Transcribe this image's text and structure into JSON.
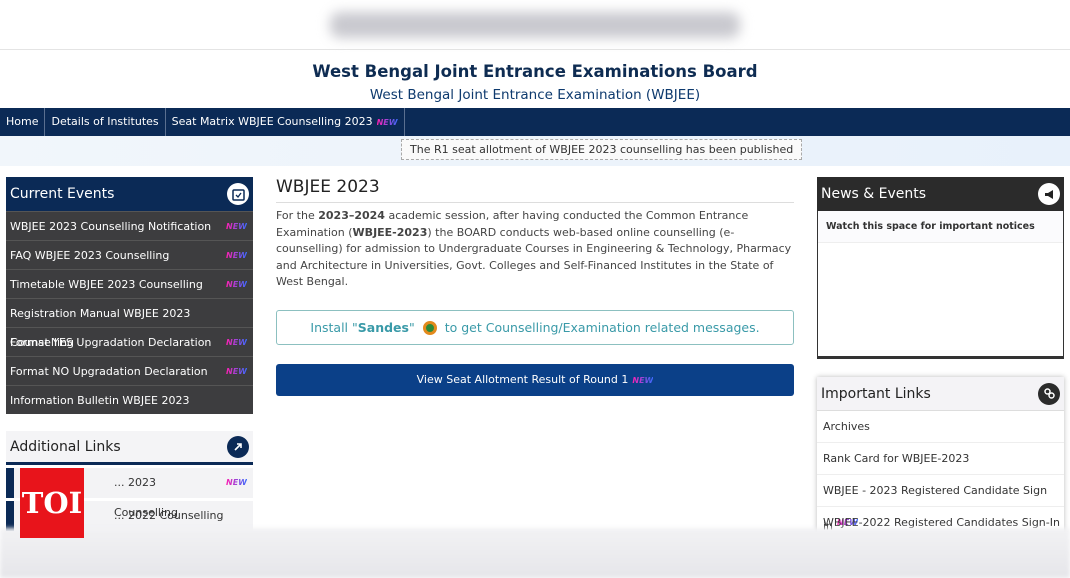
{
  "header": {
    "title": "West Bengal Joint Entrance Examinations Board",
    "subtitle": "West Bengal Joint Entrance Examination (WBJEE)"
  },
  "nav": {
    "items": [
      "Home",
      "Details of Institutes",
      "Seat Matrix WBJEE Counselling 2023"
    ],
    "new_badge": "NEW"
  },
  "notice": "The R1 seat allotment of WBJEE 2023 counselling has been published",
  "current_events": {
    "title": "Current Events",
    "items": [
      "WBJEE 2023 Counselling Notification",
      "FAQ WBJEE 2023 Counselling",
      "Timetable WBJEE 2023 Counselling",
      "Registration Manual WBJEE 2023 Counselling",
      "Format YES Upgradation Declaration",
      "Format NO Upgradation Declaration",
      "Information Bulletin WBJEE 2023"
    ]
  },
  "additional_links": {
    "title": "Additional Links",
    "items": [
      "... 2023 Counselling",
      "... 2022 Counselling"
    ]
  },
  "main": {
    "title": "WBJEE 2023",
    "p_1": "For the ",
    "p_b1": "2023–2024",
    "p_2": " academic session, after having conducted the Common Entrance Examination (",
    "p_b2": "WBJEE-2023",
    "p_3": ") the BOARD conducts web-based online counselling (e-counselling) for admission to Undergraduate Courses in Engineering & Technology, Pharmacy and Architecture in Universities, Govt. Colleges and Self-Financed Institutes in the State of West Bengal.",
    "sandes_1": "Install \"",
    "sandes_b": "Sandes",
    "sandes_2": "\"",
    "sandes_3": "to get Counselling/Examination related messages.",
    "button": "View Seat Allotment Result of Round 1"
  },
  "news": {
    "title": "News & Events",
    "item": "Watch this space for important notices"
  },
  "important_links": {
    "title": "Important Links",
    "items": [
      "Archives",
      "Rank Card for WBJEE-2023",
      "WBJEE - 2023 Registered Candidate Sign in",
      "WBJEE-2022 Registered Candidates Sign-In"
    ]
  },
  "watermark": "TOI",
  "colors": {
    "navy": "#0b2a56",
    "button": "#0b4088",
    "events_bg": "#3d3d3f",
    "toi_red": "#e8141b"
  }
}
